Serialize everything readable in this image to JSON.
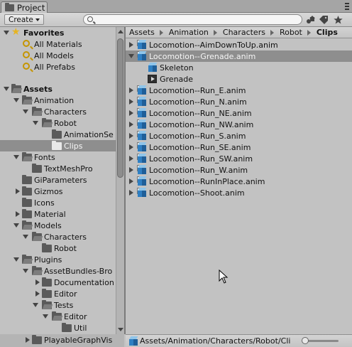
{
  "window": {
    "tab_title": "Project"
  },
  "toolbar": {
    "create_label": "Create",
    "search_value": "",
    "search_placeholder": ""
  },
  "tree": {
    "favorites_label": "Favorites",
    "favorites": [
      "All Materials",
      "All Models",
      "All Prefabs"
    ],
    "assets_label": "Assets",
    "items": [
      {
        "label": "Animation"
      },
      {
        "label": "Characters"
      },
      {
        "label": "Robot"
      },
      {
        "label": "AnimationSe"
      },
      {
        "label": "Clips"
      },
      {
        "label": "Fonts"
      },
      {
        "label": "TextMeshPro"
      },
      {
        "label": "GiParameters"
      },
      {
        "label": "Gizmos"
      },
      {
        "label": "Icons"
      },
      {
        "label": "Material"
      },
      {
        "label": "Models"
      },
      {
        "label": "Characters"
      },
      {
        "label": "Robot"
      },
      {
        "label": "Plugins"
      },
      {
        "label": "AssetBundles-Bro"
      },
      {
        "label": "Documentation"
      },
      {
        "label": "Editor"
      },
      {
        "label": "Tests"
      },
      {
        "label": "Editor"
      },
      {
        "label": "Util"
      },
      {
        "label": "PlayableGraphVis"
      }
    ]
  },
  "breadcrumb": [
    "Assets",
    "Animation",
    "Characters",
    "Robot",
    "Clips"
  ],
  "assets": [
    {
      "label": "Locomotion--AimDownToUp.anim"
    },
    {
      "label": "Locomotion--Grenade.anim"
    },
    {
      "label": "Skeleton"
    },
    {
      "label": "Grenade"
    },
    {
      "label": "Locomotion--Run_E.anim"
    },
    {
      "label": "Locomotion--Run_N.anim"
    },
    {
      "label": "Locomotion--Run_NE.anim"
    },
    {
      "label": "Locomotion--Run_NW.anim"
    },
    {
      "label": "Locomotion--Run_S.anim"
    },
    {
      "label": "Locomotion--Run_SE.anim"
    },
    {
      "label": "Locomotion--Run_SW.anim"
    },
    {
      "label": "Locomotion--Run_W.anim"
    },
    {
      "label": "Locomotion--RunInPlace.anim"
    },
    {
      "label": "Locomotion--Shoot.anim"
    }
  ],
  "status": {
    "path": "Assets/Animation/Characters/Robot/Cli"
  },
  "colors": {
    "selection": "#8e8e8e",
    "panel": "#c2c2c2",
    "favorite_star": "#e6b422",
    "prefab_blue": "#2f7fc2"
  }
}
